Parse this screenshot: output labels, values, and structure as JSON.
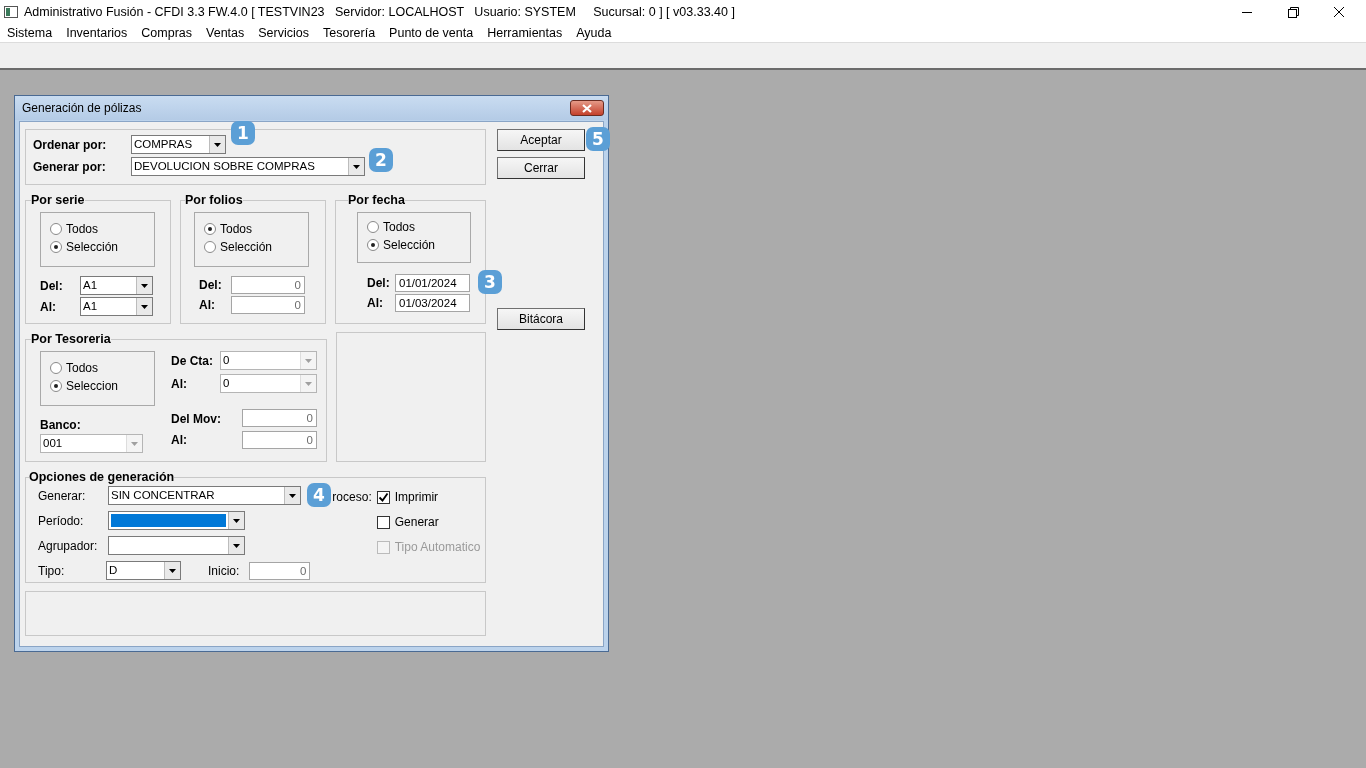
{
  "window": {
    "title": "Administrativo Fusión - CFDI 3.3 FW.4.0 [ TESTVIN23   Servidor: LOCALHOST   Usuario: SYSTEM     Sucursal: 0 ] [ v03.33.40 ]"
  },
  "menu": [
    "Sistema",
    "Inventarios",
    "Compras",
    "Ventas",
    "Servicios",
    "Tesorería",
    "Punto de venta",
    "Herramientas",
    "Ayuda"
  ],
  "dialog": {
    "title": "Generación de pólizas",
    "ordenar": {
      "label": "Ordenar por:",
      "value": "COMPRAS"
    },
    "generar_por": {
      "label": "Generar por:",
      "value": "DEVOLUCION SOBRE COMPRAS"
    },
    "buttons": [
      "Aceptar",
      "Cerrar"
    ],
    "bitacora_button": "Bitácora",
    "por_serie": {
      "title": "Por serie",
      "options": [
        {
          "label": "Todos",
          "selected": false
        },
        {
          "label": "Selección",
          "selected": true
        }
      ],
      "del": {
        "label": "Del:",
        "value": "A1"
      },
      "al": {
        "label": "Al:",
        "value": "A1"
      }
    },
    "por_folios": {
      "title": "Por folios",
      "options": [
        {
          "label": "Todos",
          "selected": true
        },
        {
          "label": "Selección",
          "selected": false
        }
      ],
      "del": {
        "label": "Del:",
        "value": "0"
      },
      "al": {
        "label": "Al:",
        "value": "0"
      }
    },
    "por_fecha": {
      "title": "Por fecha",
      "options": [
        {
          "label": "Todos",
          "selected": false
        },
        {
          "label": "Selección",
          "selected": true
        }
      ],
      "del": {
        "label": "Del:",
        "value": "01/01/2024"
      },
      "al": {
        "label": "Al:",
        "value": "01/03/2024"
      }
    },
    "por_tesoreria": {
      "title": "Por Tesoreria",
      "options": [
        {
          "label": "Todos",
          "selected": false
        },
        {
          "label": "Seleccion",
          "selected": true
        }
      ],
      "banco": {
        "label": "Banco:",
        "value": "001",
        "disabled": true
      },
      "de_cta": {
        "label": "De Cta:",
        "value": "0",
        "disabled": true
      },
      "al_cta": {
        "label": "Al:",
        "value": "0",
        "disabled": true
      },
      "del_mov": {
        "label": "Del Mov:",
        "value": "0"
      },
      "al_mov": {
        "label": "Al:",
        "value": "0"
      }
    },
    "opciones": {
      "title": "Opciones de generación",
      "generar": {
        "label": "Generar:",
        "value": "SIN CONCENTRAR",
        "highlighted": false
      },
      "periodo": {
        "label": "Período:",
        "highlighted": true
      },
      "agrupador": {
        "label": "Agrupador:",
        "highlighted": false
      },
      "tipo": {
        "label": "Tipo:",
        "value": "D",
        "highlighted": false
      },
      "inicio": {
        "label": "Inicio:",
        "value": "0"
      },
      "proceso_label": "roceso:",
      "checks": [
        {
          "label": "Imprimir",
          "checked": true,
          "disabled": false
        },
        {
          "label": "Generar",
          "checked": false,
          "disabled": false
        },
        {
          "label": "Tipo Automatico",
          "checked": false,
          "disabled": true
        }
      ]
    }
  },
  "callouts": [
    "1",
    "2",
    "3",
    "4",
    "5"
  ]
}
